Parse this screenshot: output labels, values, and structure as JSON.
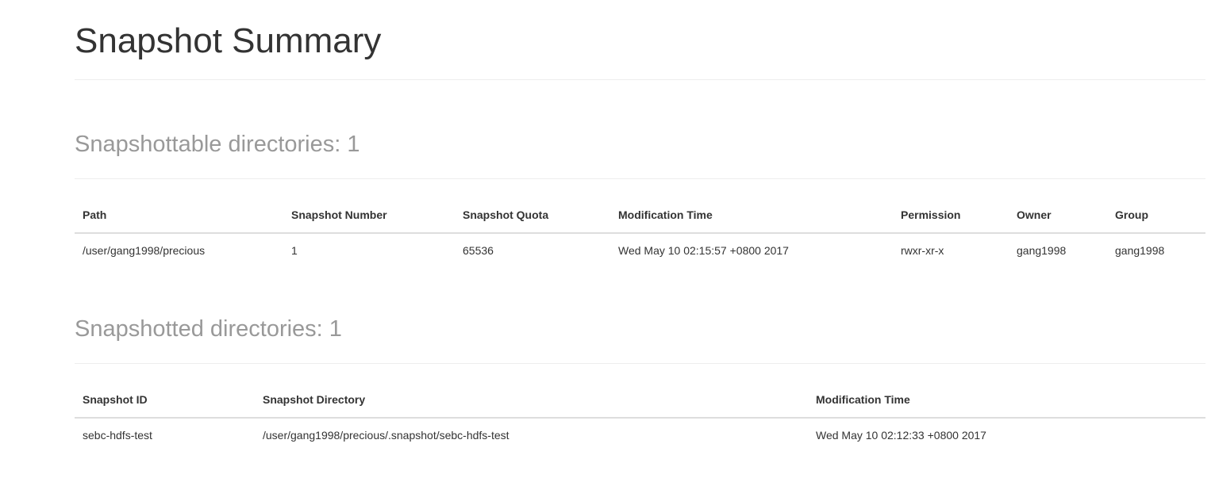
{
  "page": {
    "title": "Snapshot Summary"
  },
  "snapshottable": {
    "heading": "Snapshottable directories: 1",
    "columns": [
      "Path",
      "Snapshot Number",
      "Snapshot Quota",
      "Modification Time",
      "Permission",
      "Owner",
      "Group"
    ],
    "rows": [
      [
        "/user/gang1998/precious",
        "1",
        "65536",
        "Wed May 10 02:15:57 +0800 2017",
        "rwxr-xr-x",
        "gang1998",
        "gang1998"
      ]
    ]
  },
  "snapshotted": {
    "heading": "Snapshotted directories: 1",
    "columns": [
      "Snapshot ID",
      "Snapshot Directory",
      "Modification Time"
    ],
    "rows": [
      [
        "sebc-hdfs-test",
        "/user/gang1998/precious/.snapshot/sebc-hdfs-test",
        "Wed May 10 02:12:33 +0800 2017"
      ]
    ]
  }
}
